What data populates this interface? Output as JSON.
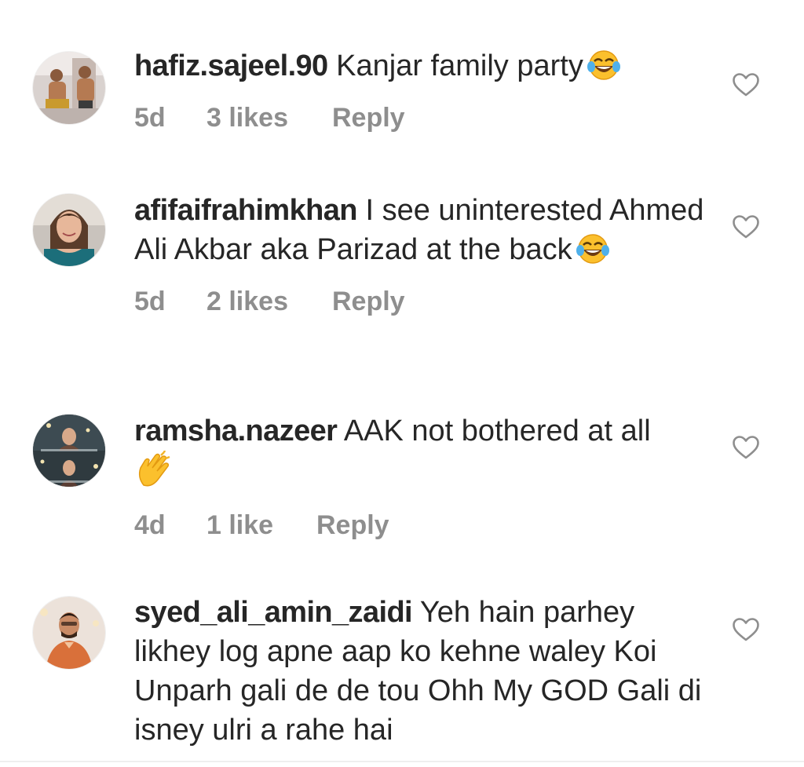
{
  "comments": [
    {
      "username": "hafiz.sajeel.90",
      "text": " Kanjar family party",
      "emoji": "😂",
      "time": "5d",
      "likes": "3 likes",
      "reply": "Reply"
    },
    {
      "username": "afifaifrahimkhan",
      "text": " I see uninterested Ahmed Ali Akbar aka Parizad at the back",
      "emoji": "😂",
      "time": "5d",
      "likes": "2 likes",
      "reply": "Reply"
    },
    {
      "username": "ramsha.nazeer",
      "text": " AAK not bothered at all",
      "emoji": "👏",
      "time": "4d",
      "likes": "1 like",
      "reply": "Reply"
    },
    {
      "username": "syed_ali_amin_zaidi",
      "text": " Yeh hain parhey likhey log apne aap ko kehne waley Koi Unparh gali de de tou Ohh My GOD Gali di isney ulri a rahe hai",
      "emoji": "",
      "time": "",
      "likes": "",
      "reply": ""
    }
  ],
  "colors": {
    "text": "#262626",
    "meta": "#8e8e8e",
    "heart_stroke": "#8e8e8e",
    "divider": "#efefef"
  },
  "icons": {
    "like": "heart-outline-icon",
    "laugh": "face-with-tears-of-joy-emoji",
    "clap": "clapping-hands-emoji"
  }
}
